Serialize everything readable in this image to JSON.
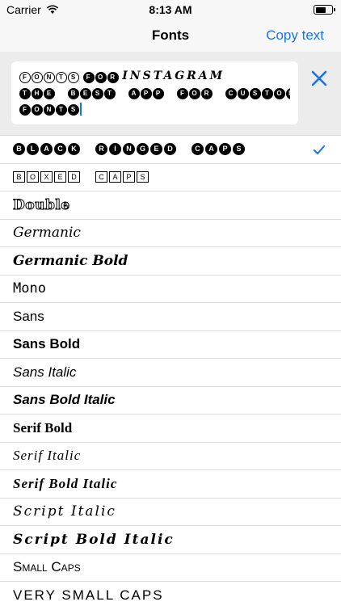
{
  "status_bar": {
    "carrier": "Carrier",
    "time": "8:13 AM"
  },
  "nav": {
    "title": "Fonts",
    "action_label": "Copy text"
  },
  "editor": {
    "line1_a": "FONTS",
    "line1_b": "FOR",
    "line1_c": "INSTAGRAM",
    "line2": "THE BEST APP FOR CUSTOM",
    "line3": "FONTS"
  },
  "fonts": [
    {
      "label": "BLACK RINGED CAPS",
      "selected": true
    },
    {
      "label": "BOXED CAPS",
      "selected": false
    },
    {
      "label": "Double",
      "selected": false
    },
    {
      "label": "Germanic",
      "selected": false
    },
    {
      "label": "Germanic Bold",
      "selected": false
    },
    {
      "label": "Mono",
      "selected": false
    },
    {
      "label": "Sans",
      "selected": false
    },
    {
      "label": "Sans Bold",
      "selected": false
    },
    {
      "label": "Sans Italic",
      "selected": false
    },
    {
      "label": "Sans Bold Italic",
      "selected": false
    },
    {
      "label": "Serif Bold",
      "selected": false
    },
    {
      "label": "Serif Italic",
      "selected": false
    },
    {
      "label": "Serif Bold Italic",
      "selected": false
    },
    {
      "label": "Script Italic",
      "selected": false
    },
    {
      "label": "Script Bold Italic",
      "selected": false
    },
    {
      "label": "Small Caps",
      "selected": false
    },
    {
      "label": "VERY SMALL CAPS",
      "selected": false
    }
  ],
  "colors": {
    "accent": "#1a73e8",
    "nav_background": "#f7f7f7",
    "editor_background": "#ececec"
  },
  "icons": {
    "wifi": "wifi-icon",
    "battery": "battery-icon",
    "clear": "close-icon",
    "check": "checkmark-icon"
  }
}
